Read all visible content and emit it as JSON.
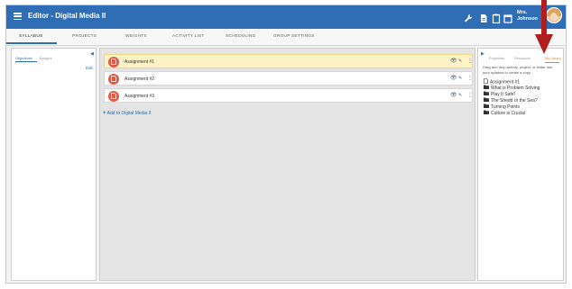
{
  "app": {
    "title": "Editor - Digital Media II"
  },
  "user": {
    "name_line1": "Mrs.",
    "name_line2": "Johnson"
  },
  "nav": {
    "tabs": [
      "SYLLABUS",
      "PROJECTS",
      "WEIGHTS",
      "ACTIVITY LIST",
      "SCHEDULING",
      "GROUP SETTINGS"
    ],
    "active": "SYLLABUS"
  },
  "left_panel": {
    "tabs": [
      "Objectives",
      "Badges"
    ],
    "active_tab": "Objectives",
    "edit_label": "Edit"
  },
  "center": {
    "assignments": [
      {
        "title": "Assignment #1",
        "highlighted": true
      },
      {
        "title": "Assignment #2",
        "highlighted": false
      },
      {
        "title": "Assignment #3",
        "highlighted": false
      }
    ],
    "add_label": "Add to Digital Media II"
  },
  "right_panel": {
    "tabs": [
      "Properties",
      "Resources",
      "My Library"
    ],
    "active_tab": "My Library",
    "instructions": "Drag and drop activity, project, or folder into your syllabus to create a copy.",
    "items": [
      {
        "label": "Assignment #1",
        "icon": "document-icon"
      },
      {
        "label": "What is Problem Solving",
        "icon": "folder-icon"
      },
      {
        "label": "Play It Safe!",
        "icon": "folder-icon"
      },
      {
        "label": "The Shedd or the Sea?",
        "icon": "folder-icon"
      },
      {
        "label": "Turning Points",
        "icon": "folder-icon"
      },
      {
        "label": "Culture is Crucial",
        "icon": "folder-icon"
      }
    ]
  },
  "colors": {
    "primary": "#2f6db5",
    "assignment_icon": "#e05a47",
    "highlight": "#fdf3c7",
    "annotation_arrow": "#b01e1e",
    "library_tab": "#e0822c"
  }
}
